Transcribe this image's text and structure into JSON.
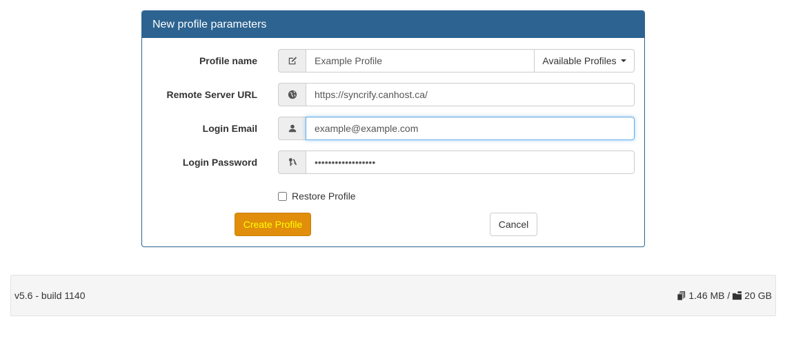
{
  "panel": {
    "title": "New profile parameters"
  },
  "form": {
    "profile_name": {
      "label": "Profile name",
      "icon": "edit-icon",
      "value": "Example Profile",
      "dropdown_label": "Available Profiles"
    },
    "server_url": {
      "label": "Remote Server URL",
      "icon": "globe-icon",
      "value": "https://syncrify.canhost.ca/"
    },
    "login_email": {
      "label": "Login Email",
      "icon": "user-icon",
      "value": "example@example.com"
    },
    "login_password": {
      "label": "Login Password",
      "icon": "keys-icon",
      "value": "••••••••••••••••••"
    },
    "restore_profile": {
      "label": "Restore Profile",
      "checked": false
    },
    "create_label": "Create Profile",
    "cancel_label": "Cancel"
  },
  "footer": {
    "version": "v5.6 - build 1140",
    "used": "1.46 MB /",
    "quota": "20 GB"
  },
  "colors": {
    "panel_header": "#2c6390",
    "create_button": "#e08e0b",
    "create_button_text": "#ffff00"
  }
}
